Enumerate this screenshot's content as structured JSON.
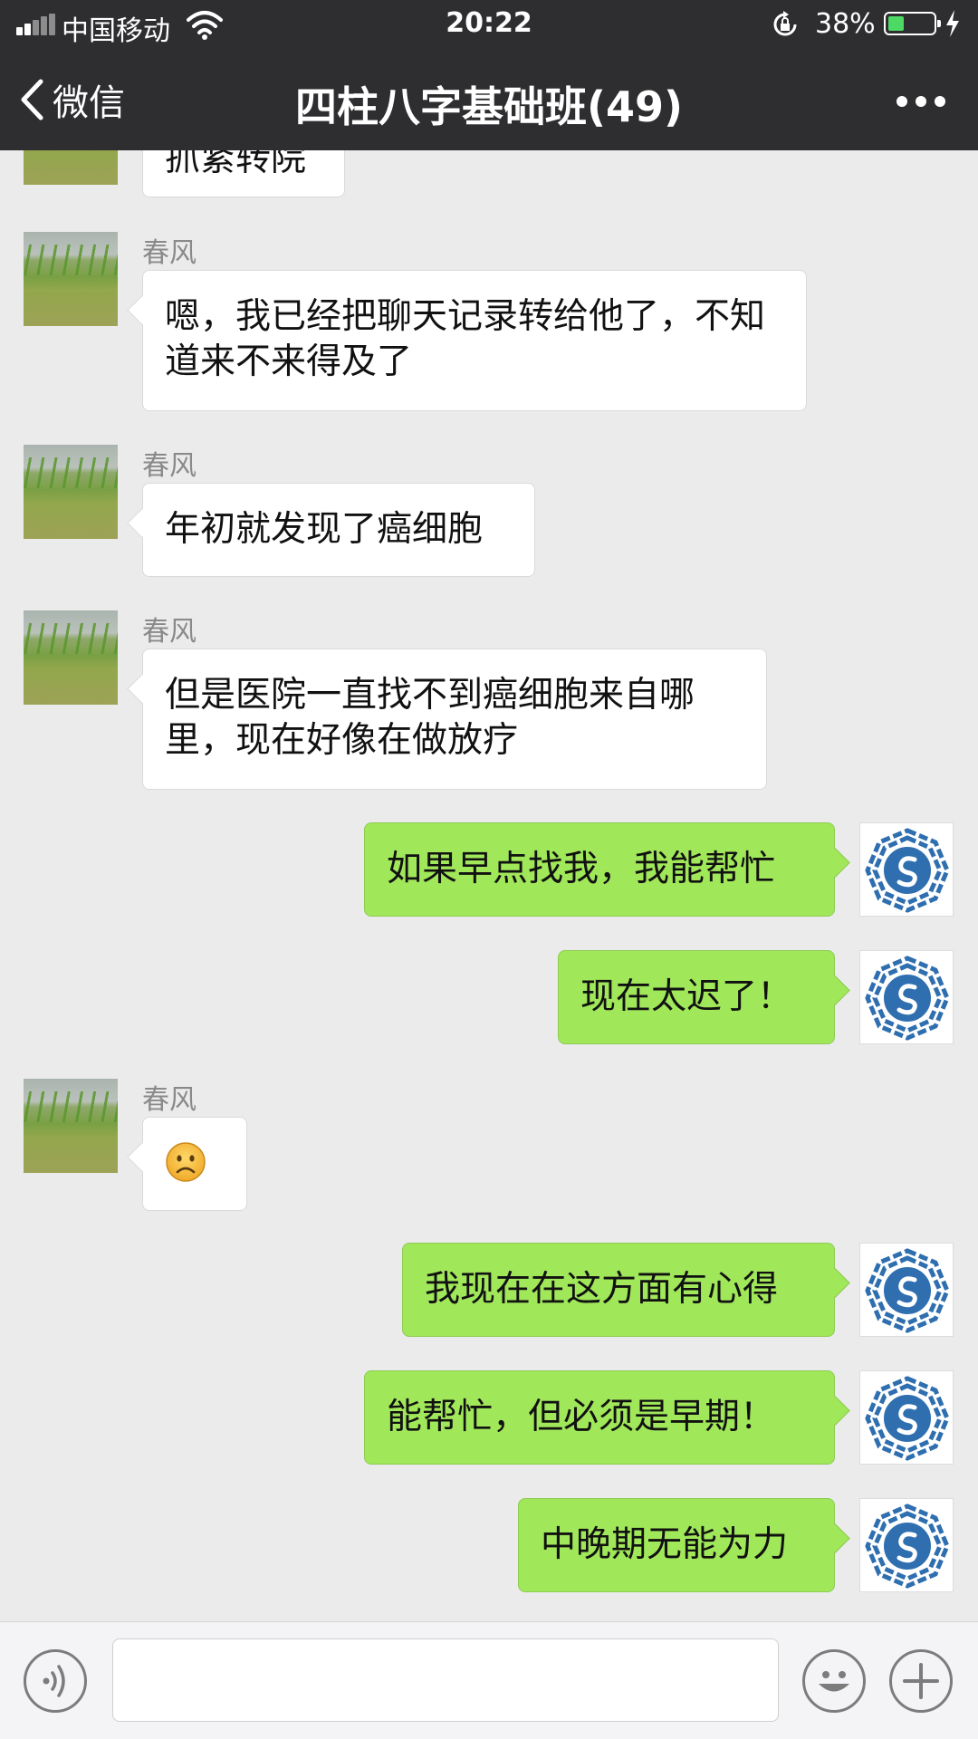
{
  "status_bar": {
    "carrier": "中国移动",
    "time": "20:22",
    "battery_percent": "38%",
    "battery_level": 0.38
  },
  "nav": {
    "back_label": "微信",
    "title": "四柱八字基础班(49)"
  },
  "messages": [
    {
      "side": "left",
      "sender": "",
      "text": "抓紧转院",
      "partial": true
    },
    {
      "side": "left",
      "sender": "春风",
      "text": "嗯，我已经把聊天记录转给他了，不知道来不来得及了"
    },
    {
      "side": "left",
      "sender": "春风",
      "text": "年初就发现了癌细胞"
    },
    {
      "side": "left",
      "sender": "春风",
      "text": "但是医院一直找不到癌细胞来自哪里，现在好像在做放疗"
    },
    {
      "side": "right",
      "text": "如果早点找我，我能帮忙"
    },
    {
      "side": "right",
      "text": "现在太迟了！"
    },
    {
      "side": "left",
      "sender": "春风",
      "emoji": "frowning-face"
    },
    {
      "side": "right",
      "text": "我现在在这方面有心得"
    },
    {
      "side": "right",
      "text": "能帮忙，但必须是早期！"
    },
    {
      "side": "right",
      "text": "中晚期无能为力"
    }
  ],
  "input_bar": {
    "voice_icon": "voice-icon",
    "input_value": "",
    "emoji_icon": "emoji-icon",
    "plus_icon": "plus-icon"
  },
  "colors": {
    "nav_background": "#2e2e31",
    "chat_background": "#ebebeb",
    "outgoing_bubble": "#a0e75a",
    "incoming_bubble": "#ffffff",
    "battery_fill": "#4cd964"
  }
}
